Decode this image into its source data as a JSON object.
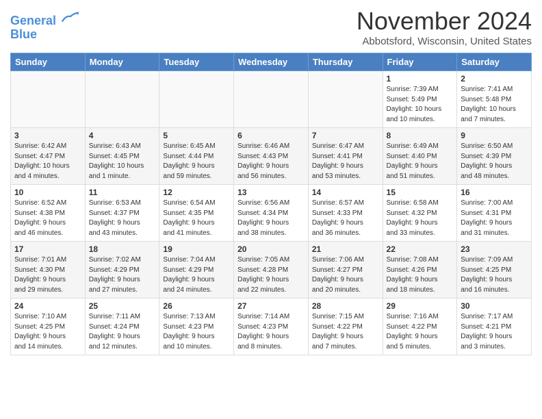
{
  "logo": {
    "line1": "General",
    "line2": "Blue"
  },
  "header": {
    "month_year": "November 2024",
    "location": "Abbotsford, Wisconsin, United States"
  },
  "weekdays": [
    "Sunday",
    "Monday",
    "Tuesday",
    "Wednesday",
    "Thursday",
    "Friday",
    "Saturday"
  ],
  "rows": [
    [
      {
        "day": "",
        "info": ""
      },
      {
        "day": "",
        "info": ""
      },
      {
        "day": "",
        "info": ""
      },
      {
        "day": "",
        "info": ""
      },
      {
        "day": "",
        "info": ""
      },
      {
        "day": "1",
        "info": "Sunrise: 7:39 AM\nSunset: 5:49 PM\nDaylight: 10 hours\nand 10 minutes."
      },
      {
        "day": "2",
        "info": "Sunrise: 7:41 AM\nSunset: 5:48 PM\nDaylight: 10 hours\nand 7 minutes."
      }
    ],
    [
      {
        "day": "3",
        "info": "Sunrise: 6:42 AM\nSunset: 4:47 PM\nDaylight: 10 hours\nand 4 minutes."
      },
      {
        "day": "4",
        "info": "Sunrise: 6:43 AM\nSunset: 4:45 PM\nDaylight: 10 hours\nand 1 minute."
      },
      {
        "day": "5",
        "info": "Sunrise: 6:45 AM\nSunset: 4:44 PM\nDaylight: 9 hours\nand 59 minutes."
      },
      {
        "day": "6",
        "info": "Sunrise: 6:46 AM\nSunset: 4:43 PM\nDaylight: 9 hours\nand 56 minutes."
      },
      {
        "day": "7",
        "info": "Sunrise: 6:47 AM\nSunset: 4:41 PM\nDaylight: 9 hours\nand 53 minutes."
      },
      {
        "day": "8",
        "info": "Sunrise: 6:49 AM\nSunset: 4:40 PM\nDaylight: 9 hours\nand 51 minutes."
      },
      {
        "day": "9",
        "info": "Sunrise: 6:50 AM\nSunset: 4:39 PM\nDaylight: 9 hours\nand 48 minutes."
      }
    ],
    [
      {
        "day": "10",
        "info": "Sunrise: 6:52 AM\nSunset: 4:38 PM\nDaylight: 9 hours\nand 46 minutes."
      },
      {
        "day": "11",
        "info": "Sunrise: 6:53 AM\nSunset: 4:37 PM\nDaylight: 9 hours\nand 43 minutes."
      },
      {
        "day": "12",
        "info": "Sunrise: 6:54 AM\nSunset: 4:35 PM\nDaylight: 9 hours\nand 41 minutes."
      },
      {
        "day": "13",
        "info": "Sunrise: 6:56 AM\nSunset: 4:34 PM\nDaylight: 9 hours\nand 38 minutes."
      },
      {
        "day": "14",
        "info": "Sunrise: 6:57 AM\nSunset: 4:33 PM\nDaylight: 9 hours\nand 36 minutes."
      },
      {
        "day": "15",
        "info": "Sunrise: 6:58 AM\nSunset: 4:32 PM\nDaylight: 9 hours\nand 33 minutes."
      },
      {
        "day": "16",
        "info": "Sunrise: 7:00 AM\nSunset: 4:31 PM\nDaylight: 9 hours\nand 31 minutes."
      }
    ],
    [
      {
        "day": "17",
        "info": "Sunrise: 7:01 AM\nSunset: 4:30 PM\nDaylight: 9 hours\nand 29 minutes."
      },
      {
        "day": "18",
        "info": "Sunrise: 7:02 AM\nSunset: 4:29 PM\nDaylight: 9 hours\nand 27 minutes."
      },
      {
        "day": "19",
        "info": "Sunrise: 7:04 AM\nSunset: 4:29 PM\nDaylight: 9 hours\nand 24 minutes."
      },
      {
        "day": "20",
        "info": "Sunrise: 7:05 AM\nSunset: 4:28 PM\nDaylight: 9 hours\nand 22 minutes."
      },
      {
        "day": "21",
        "info": "Sunrise: 7:06 AM\nSunset: 4:27 PM\nDaylight: 9 hours\nand 20 minutes."
      },
      {
        "day": "22",
        "info": "Sunrise: 7:08 AM\nSunset: 4:26 PM\nDaylight: 9 hours\nand 18 minutes."
      },
      {
        "day": "23",
        "info": "Sunrise: 7:09 AM\nSunset: 4:25 PM\nDaylight: 9 hours\nand 16 minutes."
      }
    ],
    [
      {
        "day": "24",
        "info": "Sunrise: 7:10 AM\nSunset: 4:25 PM\nDaylight: 9 hours\nand 14 minutes."
      },
      {
        "day": "25",
        "info": "Sunrise: 7:11 AM\nSunset: 4:24 PM\nDaylight: 9 hours\nand 12 minutes."
      },
      {
        "day": "26",
        "info": "Sunrise: 7:13 AM\nSunset: 4:23 PM\nDaylight: 9 hours\nand 10 minutes."
      },
      {
        "day": "27",
        "info": "Sunrise: 7:14 AM\nSunset: 4:23 PM\nDaylight: 9 hours\nand 8 minutes."
      },
      {
        "day": "28",
        "info": "Sunrise: 7:15 AM\nSunset: 4:22 PM\nDaylight: 9 hours\nand 7 minutes."
      },
      {
        "day": "29",
        "info": "Sunrise: 7:16 AM\nSunset: 4:22 PM\nDaylight: 9 hours\nand 5 minutes."
      },
      {
        "day": "30",
        "info": "Sunrise: 7:17 AM\nSunset: 4:21 PM\nDaylight: 9 hours\nand 3 minutes."
      }
    ]
  ]
}
